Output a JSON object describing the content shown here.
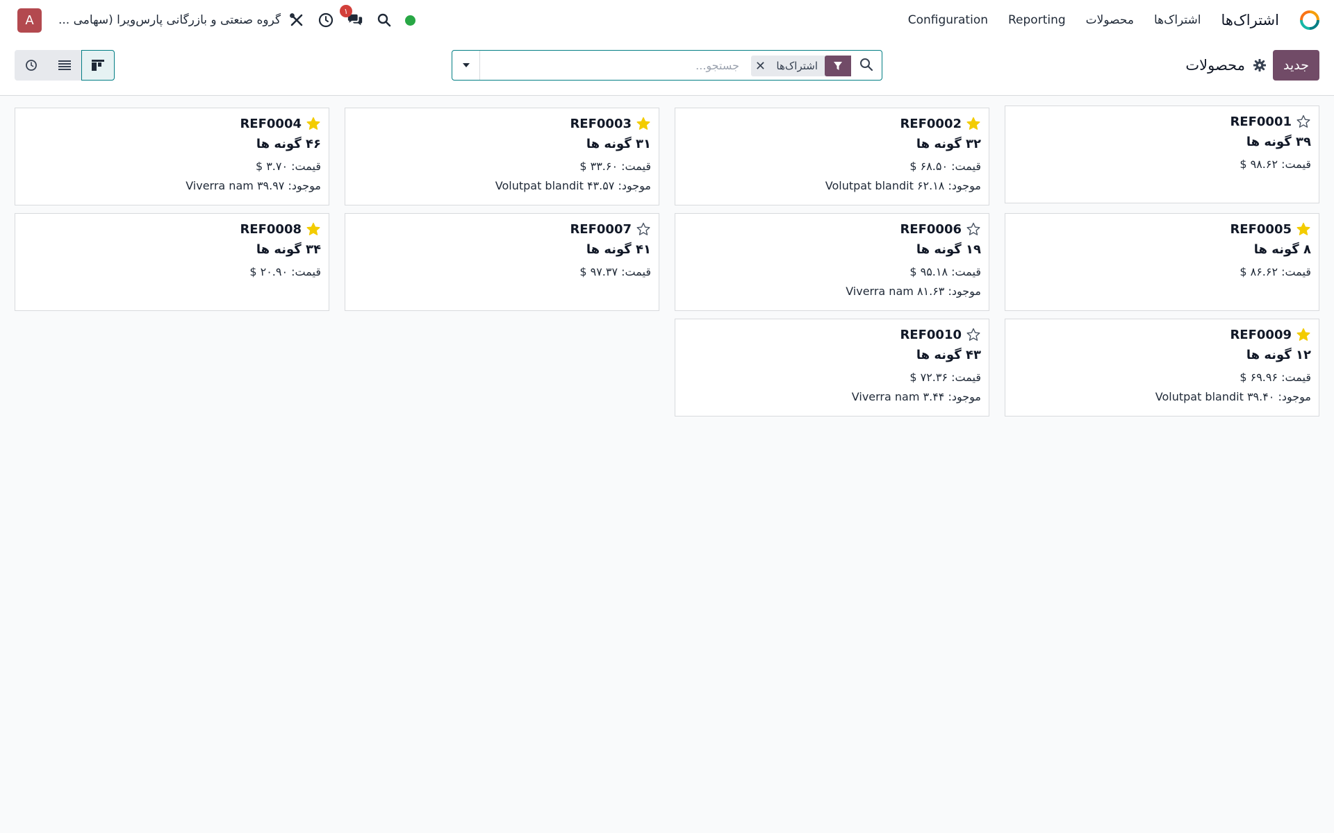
{
  "navbar": {
    "app_name": "اشتراک‌ها",
    "menu": [
      "اشتراک‌ها",
      "محصولات",
      "Reporting",
      "Configuration"
    ],
    "company": "گروه صنعتی و بازرگانی پارس‌ویرا (سهامی ...",
    "avatar_letter": "A",
    "chat_badge": "۱"
  },
  "control": {
    "new_label": "جدید",
    "page_title": "محصولات",
    "search": {
      "facet_label": "اشتراک‌ها",
      "placeholder": "جستجو..."
    }
  },
  "products": [
    {
      "ref": "REF0001",
      "starred": false,
      "variants": "۳۹ گونه ها",
      "price": "قیمت: ۹۸.۶۲ $",
      "stock": ""
    },
    {
      "ref": "REF0002",
      "starred": true,
      "variants": "۳۲ گونه ها",
      "price": "قیمت: ۶۸.۵۰ $",
      "stock": "موجود: ۶۲.۱۸ Volutpat blandit"
    },
    {
      "ref": "REF0003",
      "starred": true,
      "variants": "۳۱ گونه ها",
      "price": "قیمت: ۳۳.۶۰ $",
      "stock": "موجود: ۴۳.۵۷ Volutpat blandit"
    },
    {
      "ref": "REF0004",
      "starred": true,
      "variants": "۴۶ گونه ها",
      "price": "قیمت: ۳.۷۰ $",
      "stock": "موجود: ۳۹.۹۷ Viverra nam"
    },
    {
      "ref": "REF0005",
      "starred": true,
      "variants": "۸ گونه ها",
      "price": "قیمت: ۸۶.۶۲ $",
      "stock": ""
    },
    {
      "ref": "REF0006",
      "starred": false,
      "variants": "۱۹ گونه ها",
      "price": "قیمت: ۹۵.۱۸ $",
      "stock": "موجود: ۸۱.۶۳ Viverra nam"
    },
    {
      "ref": "REF0007",
      "starred": false,
      "variants": "۴۱ گونه ها",
      "price": "قیمت: ۹۷.۳۷ $",
      "stock": ""
    },
    {
      "ref": "REF0008",
      "starred": true,
      "variants": "۳۴ گونه ها",
      "price": "قیمت: ۲۰.۹۰ $",
      "stock": ""
    },
    {
      "ref": "REF0009",
      "starred": true,
      "variants": "۱۲ گونه ها",
      "price": "قیمت: ۶۹.۹۶ $",
      "stock": "موجود: ۳۹.۴۰ Volutpat blandit"
    },
    {
      "ref": "REF0010",
      "starred": false,
      "variants": "۴۳ گونه ها",
      "price": "قیمت: ۷۲.۳۶ $",
      "stock": "موجود: ۳.۴۴ Viverra nam"
    }
  ],
  "colors": {
    "brand": "#714b67",
    "accent": "#017e84",
    "star": "#f3cc00",
    "status": "#28a745"
  }
}
